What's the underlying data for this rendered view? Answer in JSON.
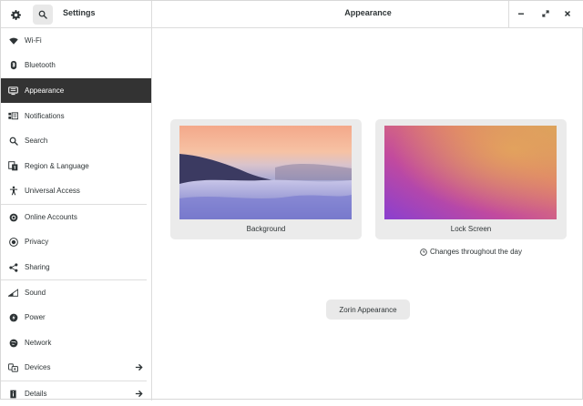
{
  "header": {
    "settings_title": "Settings",
    "page_title": "Appearance"
  },
  "sidebar": {
    "items": [
      {
        "label": "Wi-Fi",
        "icon": "wifi-icon"
      },
      {
        "label": "Bluetooth",
        "icon": "bluetooth-icon"
      },
      {
        "label": "Appearance",
        "icon": "display-icon",
        "active": true
      },
      {
        "label": "Notifications",
        "icon": "notifications-icon"
      },
      {
        "label": "Search",
        "icon": "search-icon"
      },
      {
        "label": "Region & Language",
        "icon": "region-icon"
      },
      {
        "label": "Universal Access",
        "icon": "accessibility-icon"
      },
      {
        "label": "Online Accounts",
        "icon": "online-accounts-icon"
      },
      {
        "label": "Privacy",
        "icon": "privacy-icon"
      },
      {
        "label": "Sharing",
        "icon": "share-icon"
      },
      {
        "label": "Sound",
        "icon": "sound-icon"
      },
      {
        "label": "Power",
        "icon": "power-icon"
      },
      {
        "label": "Network",
        "icon": "network-icon"
      },
      {
        "label": "Devices",
        "icon": "devices-icon",
        "arrow": true
      },
      {
        "label": "Details",
        "icon": "details-icon",
        "arrow": true
      }
    ]
  },
  "main": {
    "background_label": "Background",
    "lock_screen_label": "Lock Screen",
    "changes_label": "Changes throughout the day",
    "zorin_button_label": "Zorin Appearance"
  },
  "colors": {
    "active_item_bg": "#333333",
    "tile_bg": "#ebebeb",
    "button_bg": "#e9e9e9"
  }
}
